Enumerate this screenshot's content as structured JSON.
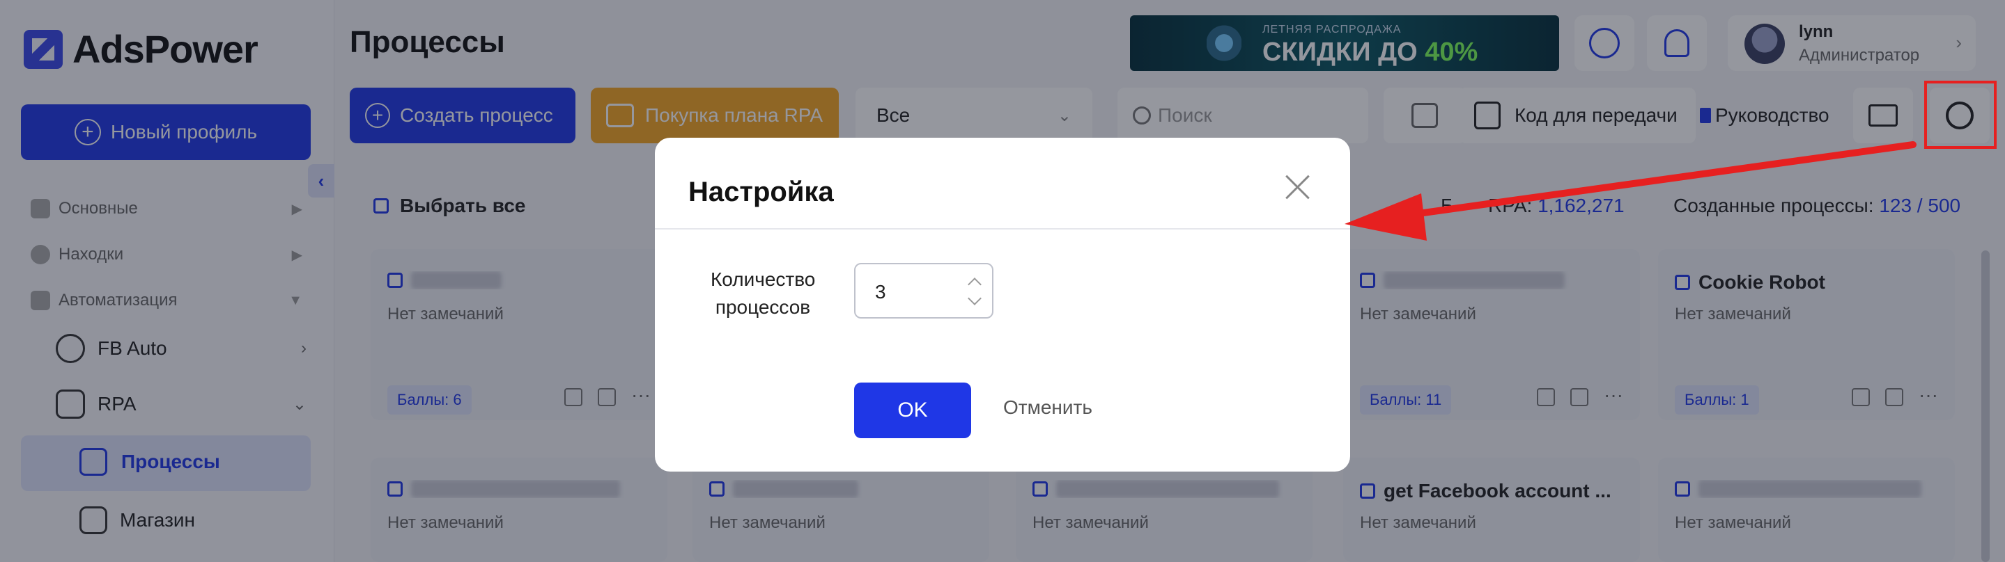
{
  "app": {
    "logo_text": "AdsPower"
  },
  "sidebar": {
    "new_profile_label": "Новый профиль",
    "collapse_icon": "chevron-left-icon",
    "sections": [
      {
        "label": "Основные"
      },
      {
        "label": "Находки"
      },
      {
        "label": "Автоматизация"
      }
    ],
    "sub_items": [
      {
        "label": "FB Auto"
      },
      {
        "label": "RPA"
      }
    ],
    "active_item": "Процессы",
    "store_item": "Магазин"
  },
  "header": {
    "page_title": "Процессы",
    "banner": {
      "small_text": "ЛЕТНЯЯ РАСПРОДАЖА",
      "big_text": "СКИДКИ ДО",
      "big_accent": "40%"
    },
    "user": {
      "name": "lynn",
      "role": "Администратор"
    }
  },
  "toolbar": {
    "create_label": "Создать процесс",
    "rpa_plan_label": "Покупка плана RPA",
    "filter_value": "Все",
    "search_placeholder": "Поиск",
    "transfer_label": "Код для передачи",
    "guide_label": "Руководство"
  },
  "content": {
    "select_all_label": "Выбрать все",
    "balance_label": "Баланс RPA:",
    "balance_partial_label": "Б",
    "balance_value": "1,162,271",
    "created_label": "Созданные процессы:",
    "created_value": "123 / 500",
    "cards_row1": [
      {
        "title": "",
        "note": "Нет замечаний",
        "badge": "Баллы: 6"
      },
      {
        "title": "",
        "note": "Нет замечаний",
        "badge": "Баллы: 11"
      },
      {
        "title": "Cookie Robot",
        "note": "Нет замечаний",
        "badge": "Баллы: 1"
      }
    ],
    "cards_row2": [
      {
        "title": "",
        "note": "Нет замечаний"
      },
      {
        "title": "",
        "note": "Нет замечаний"
      },
      {
        "title": "",
        "note": "Нет замечаний"
      },
      {
        "title": "get Facebook account ...",
        "note": "Нет замечаний"
      },
      {
        "title": "",
        "note": "Нет замечаний"
      }
    ]
  },
  "modal": {
    "title": "Настройка",
    "field_label": "Количество процессов",
    "field_value": "3",
    "ok_label": "OK",
    "cancel_label": "Отменить"
  },
  "colors": {
    "accent": "#1f37e6",
    "rpa_button": "#f5a623",
    "annotation": "#e62020"
  }
}
